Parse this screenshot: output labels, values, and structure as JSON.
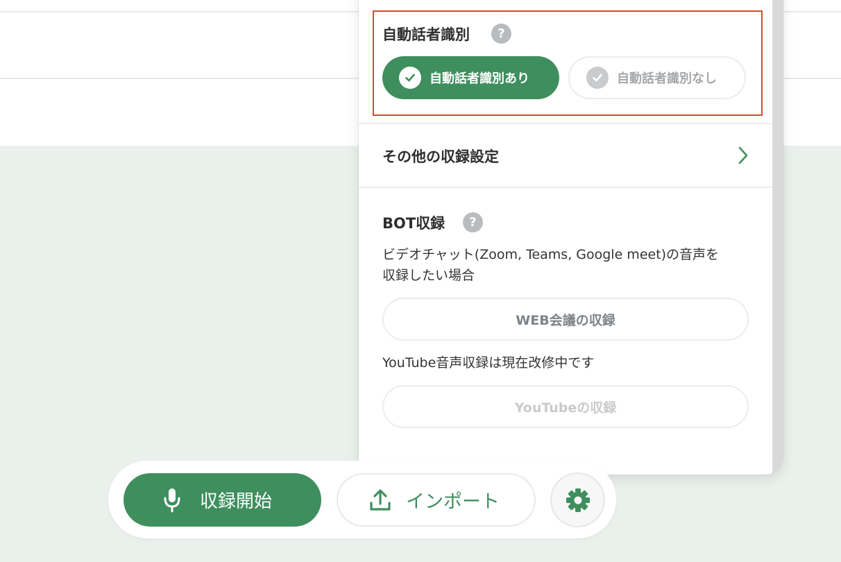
{
  "speaker_detection": {
    "title": "自動話者識別",
    "help_icon": "?",
    "option_on_label": "自動話者識別あり",
    "option_off_label": "自動話者識別なし",
    "selected": "on"
  },
  "other_settings": {
    "label": "その他の収録設定"
  },
  "bot_recording": {
    "title": "BOT収録",
    "help_icon": "?",
    "description_line1": "ビデオチャット(Zoom, Teams, Google meet)の音声を",
    "description_line2": "収録したい場合",
    "web_meeting_button": "WEB会議の収録",
    "youtube_note": "YouTube音声収録は現在改修中です",
    "youtube_button": "YouTubeの収録"
  },
  "toolbar": {
    "record_label": "収録開始",
    "import_label": "インポート"
  },
  "colors": {
    "accent_green": "#3f8f5e",
    "highlight_red": "#d8492f",
    "background_mint": "#eaf1ed"
  }
}
